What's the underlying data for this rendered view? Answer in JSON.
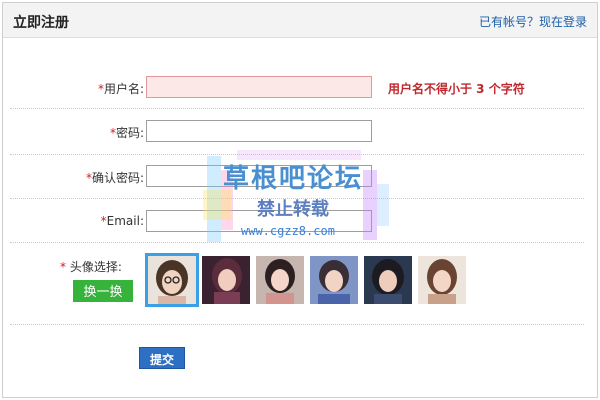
{
  "header": {
    "title": "立即注册",
    "login_link": "已有帐号？现在登录"
  },
  "form": {
    "username": {
      "star": "*",
      "label": "用户名:",
      "value": "",
      "error": "用户名不得小于 3 个字符"
    },
    "password": {
      "star": "*",
      "label": "密码:",
      "value": ""
    },
    "confirm_password": {
      "star": "*",
      "label": "确认密码:",
      "value": ""
    },
    "email": {
      "star": "*",
      "label": "Email:",
      "value": ""
    },
    "avatar": {
      "star": "*",
      "label": "头像选择:",
      "swap_button": "换一换",
      "selected_index": 0,
      "count": 6
    },
    "submit_label": "提交"
  },
  "watermark": {
    "title": "草根吧论坛",
    "subtitle": "禁止转载",
    "url": "www.cgzz8.com"
  },
  "colors": {
    "accent": "#2d6fc2",
    "error": "#c0282d",
    "swap_green": "#35b33a",
    "link": "#1a5fa8"
  }
}
